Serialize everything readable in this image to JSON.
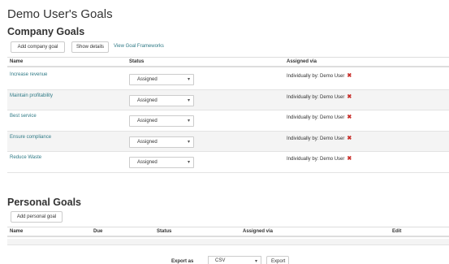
{
  "page": {
    "title": "Demo User's Goals"
  },
  "company": {
    "title": "Company Goals",
    "add_button": "Add company goal",
    "show_details_button": "Show details",
    "view_frameworks_link": "View Goal Frameworks",
    "columns": {
      "name": "Name",
      "status": "Status",
      "assigned_via": "Assigned via"
    },
    "rows": [
      {
        "name": "Increase revenue",
        "status": "Assigned",
        "assigned_via": "Individually by: Demo User"
      },
      {
        "name": "Maintain profitability",
        "status": "Assigned",
        "assigned_via": "Individually by: Demo User"
      },
      {
        "name": "Best service",
        "status": "Assigned",
        "assigned_via": "Individually by: Demo User"
      },
      {
        "name": "Ensure compliance",
        "status": "Assigned",
        "assigned_via": "Individually by: Demo User"
      },
      {
        "name": "Reduce Waste",
        "status": "Assigned",
        "assigned_via": "Individually by: Demo User"
      }
    ]
  },
  "personal": {
    "title": "Personal Goals",
    "add_button": "Add personal goal",
    "columns": {
      "name": "Name",
      "due": "Due",
      "status": "Status",
      "assigned_via": "Assigned via",
      "edit": "Edit"
    }
  },
  "export": {
    "label": "Export as",
    "format": "CSV",
    "button": "Export"
  },
  "colors": {
    "link": "#2f7a86",
    "delete": "#c9302c",
    "stripe": "#f4f4f4"
  },
  "icons": {
    "caret": "caret-down-icon",
    "delete": "delete-x-icon"
  }
}
